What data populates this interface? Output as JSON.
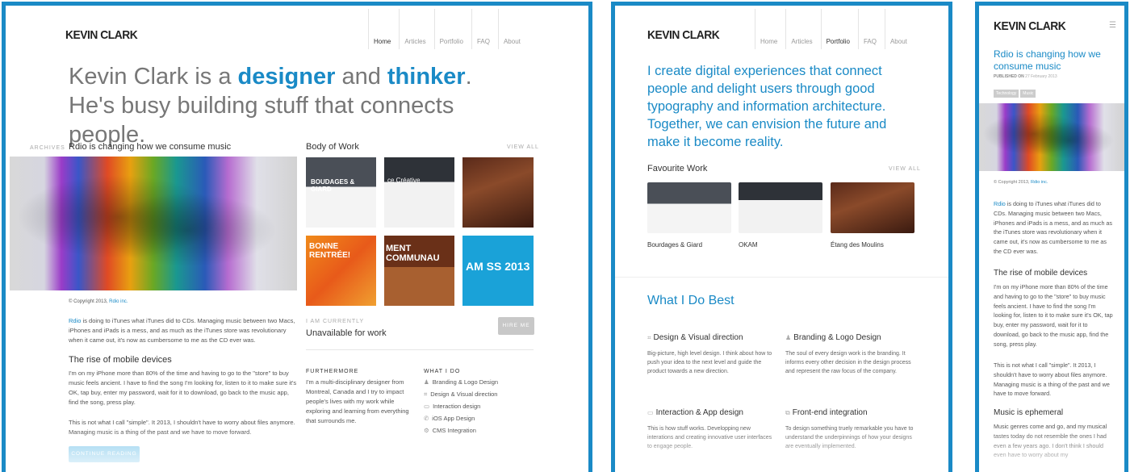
{
  "desktop": {
    "logo": "KEVIN CLARK",
    "nav": [
      "Home",
      "Articles",
      "Portfolio",
      "FAQ",
      "About"
    ],
    "hero": {
      "pre": "Kevin Clark is a ",
      "word1": "designer",
      "mid": " and ",
      "word2": "thinker",
      "post": ". He's busy building stuff that connects people."
    },
    "archives_label": "ARCHIVES",
    "article": {
      "title": "Rdio is changing how we consume music",
      "copyright_pre": "© Copyright 2013, ",
      "copyright_link": "Rdio inc.",
      "intro_link": "Rdio",
      "intro": " is doing to iTunes what iTunes did to CDs. Managing music between two Macs, iPhones and iPads is a mess, and as much as the iTunes store was revolutionary when it came out, it's now as cumbersome to me as the CD ever was.",
      "sub1": "The rise of mobile devices",
      "p1": "I'm on my iPhone more than 80% of the time and having to go to the \"store\" to buy music feels ancient. I have to find the song I'm looking for, listen to it to make sure it's OK, tap buy, enter my password, wait for it to download, go back to the music app, find the song, press play.",
      "p2": "This is not what I call \"simple\". It 2013, I shouldn't have to worry about files anymore. Managing music is a thing of the past and we have to move forward.",
      "continue": "CONTINUE READING"
    },
    "body_of_work": {
      "title": "Body of Work",
      "view_all": "VIEW ALL",
      "thumbs": [
        "BOUDAGES & GIARD",
        "ce Créative",
        "",
        "BONNE RENTRÉE!",
        "MENT COMMUNAU",
        "AM SS 2013"
      ]
    },
    "currently": {
      "label": "I AM CURRENTLY",
      "status": "Unavailable for work",
      "hire": "HIRE ME"
    },
    "furthermore": {
      "label": "FURTHERMORE",
      "text": "I'm a multi-disciplinary designer from Montreal, Canada and I try to impact people's lives with my work while exploring and learning from everything that surrounds me."
    },
    "what_i_do": {
      "label": "WHAT I DO",
      "items": [
        {
          "icon": "person-icon",
          "glyph": "♟",
          "label": "Branding & Logo Design"
        },
        {
          "icon": "crop-icon",
          "glyph": "⌗",
          "label": "Design & Visual direction"
        },
        {
          "icon": "monitor-icon",
          "glyph": "▭",
          "label": "Interaction design"
        },
        {
          "icon": "phone-icon",
          "glyph": "✆",
          "label": "iOS App Design"
        },
        {
          "icon": "gear-icon",
          "glyph": "⚙",
          "label": "CMS Integration"
        }
      ]
    }
  },
  "tablet": {
    "logo": "KEVIN CLARK",
    "nav": [
      "Home",
      "Articles",
      "Portfolio",
      "FAQ",
      "About"
    ],
    "tagline": "I create digital experiences that connect people and delight users through good typography and information architecture. Together, we can envision the future and make it become reality.",
    "favourite_work": {
      "title": "Favourite Work",
      "view_all": "VIEW ALL",
      "items": [
        "Bourdages & Giard",
        "OKAM",
        "Étang des Moulins"
      ]
    },
    "best": {
      "title": "What I Do Best",
      "skills": [
        {
          "icon": "crop-icon",
          "glyph": "⌗",
          "title": "Design & Visual direction",
          "text": "Big-picture, high level design. I think about how to push your idea to the next level and guide the product towards a new direction."
        },
        {
          "icon": "person-icon",
          "glyph": "♟",
          "title": "Branding & Logo Design",
          "text": "The soul of every design work is the branding. It informs every other decision in the design process and represent the raw focus of the company."
        },
        {
          "icon": "monitor-icon",
          "glyph": "▭",
          "title": "Interaction & App design",
          "text": "This is how stuff works. Developping new interations and creating innovative user interfaces to engage people."
        },
        {
          "icon": "code-icon",
          "glyph": "⧉",
          "title": "Front-end integration",
          "text": "To design something truely remarkable you have to understand the underpinnings of how your designs are eventually implemented."
        }
      ]
    }
  },
  "mobile": {
    "logo": "KEVIN CLARK",
    "menu_glyph": "☰",
    "title": "Rdio is changing how we consume music",
    "published_label": "PUBLISHED ON",
    "published_date": "27 February 2013",
    "tags": [
      "Technology",
      "Music"
    ],
    "copyright_pre": "© Copyright 2013, ",
    "copyright_link": "Rdio inc.",
    "intro_link": "Rdio",
    "intro": " is doing to iTunes what iTunes did to CDs. Managing music between two Macs, iPhones and iPads is a mess, and as much as the iTunes store was revolutionary when it came out, it's now as cumbersome to me as the CD ever was.",
    "sub1": "The rise of mobile devices",
    "p1": "I'm on my iPhone more than 80% of the time and having to go to the \"store\" to buy music feels ancient. I have to find the song I'm looking for, listen to it to make sure it's OK, tap buy, enter my password, wait for it to download, go back to the music app, find the song, press play.",
    "p2": "This is not what I call \"simple\". It 2013, I shouldn't have to worry about files anymore. Managing music is a thing of the past and we have to move forward.",
    "sub2": "Music is ephemeral",
    "p3": "Music genres come and go, and my musical tastes today do not resemble the ones I had even a few years ago. I don't think I should even have to worry about my"
  }
}
